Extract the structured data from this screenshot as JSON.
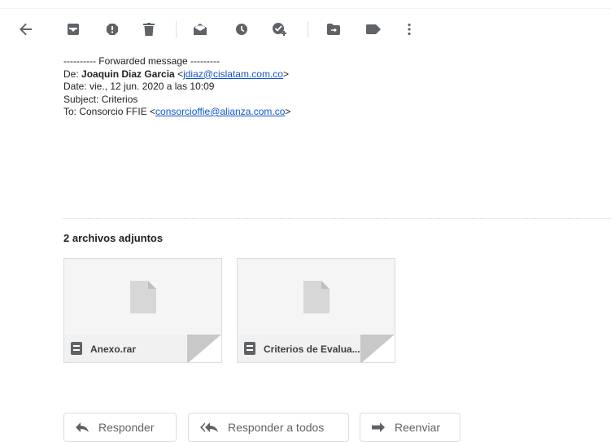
{
  "toolbar": {
    "icons": [
      "back-arrow-icon",
      "archive-icon",
      "report-spam-icon",
      "delete-icon",
      "mark-unread-icon",
      "snooze-icon",
      "add-task-icon",
      "move-to-icon",
      "label-icon",
      "more-vert-icon"
    ]
  },
  "forwarded": {
    "header": "---------- Forwarded message ---------",
    "from_label": "De:",
    "from_name": "Joaquin Diaz Garcia",
    "from_open": "<",
    "from_email": "jdiaz@cislatam.com.co",
    "from_close": ">",
    "date": "Date: vie., 12 jun. 2020 a las 10:09",
    "subject": "Subject: Criterios",
    "to_prefix": "To: Consorcio FFIE <",
    "to_email": "consorcioffie@alianza.com.co",
    "to_close": ">"
  },
  "attachments": {
    "title": "2 archivos adjuntos",
    "items": [
      {
        "name": "Anexo.rar"
      },
      {
        "name": "Criterios de Evalua..."
      }
    ]
  },
  "actions": {
    "reply": "Responder",
    "reply_all": "Responder a todos",
    "forward": "Reenviar"
  },
  "colors": {
    "icon": "#5f6368",
    "link": "#1155cc"
  }
}
